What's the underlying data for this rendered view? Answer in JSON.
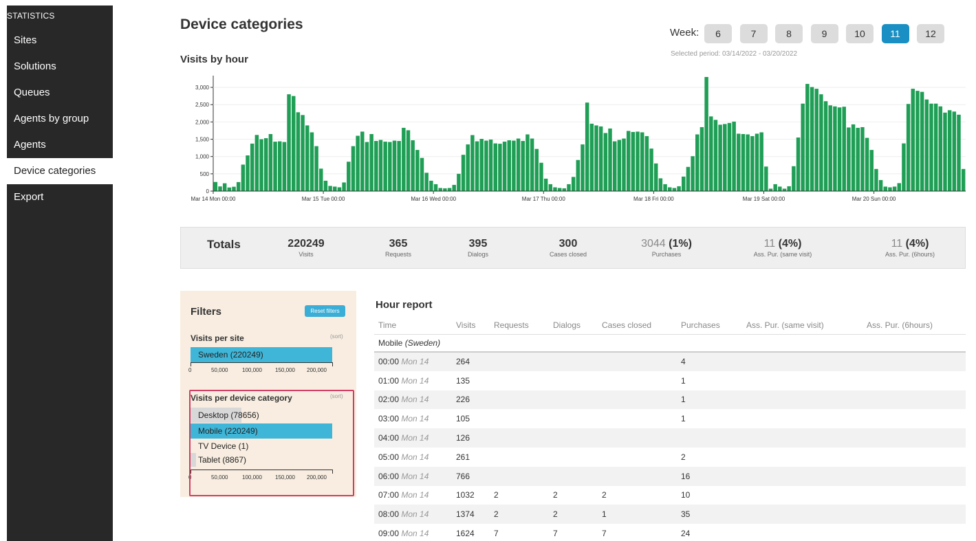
{
  "sidebar": {
    "header": "STATISTICS",
    "items": [
      {
        "label": "Sites"
      },
      {
        "label": "Solutions"
      },
      {
        "label": "Queues"
      },
      {
        "label": "Agents by group"
      },
      {
        "label": "Agents"
      },
      {
        "label": "Device categories",
        "active": true
      },
      {
        "label": "Export"
      }
    ]
  },
  "page": {
    "title": "Device categories",
    "week_label": "Week:",
    "weeks": [
      "6",
      "7",
      "8",
      "9",
      "10",
      "11",
      "12"
    ],
    "active_week": "11",
    "period": "Selected period: 03/14/2022 - 03/20/2022"
  },
  "chart_data": {
    "type": "bar",
    "title": "Visits by hour",
    "y_ticks": [
      "0",
      "500",
      "1,000",
      "1,500",
      "2,000",
      "2,500",
      "3,000"
    ],
    "ylim": [
      0,
      3300
    ],
    "x_labels": [
      "Mar 14 Mon 00:00",
      "Mar 15 Tue 00:00",
      "Mar 16 Wed 00:00",
      "Mar 17 Thu 00:00",
      "Mar 18 Fri 00:00",
      "Mar 19 Sat 00:00",
      "Mar 20 Sun 00:00"
    ],
    "bar_color": "#1f9e55",
    "values": [
      264,
      135,
      226,
      105,
      126,
      261,
      766,
      1032,
      1374,
      1624,
      1500,
      1530,
      1650,
      1430,
      1440,
      1420,
      2800,
      2750,
      2280,
      2200,
      1900,
      1700,
      1300,
      650,
      300,
      150,
      130,
      110,
      250,
      850,
      1300,
      1600,
      1720,
      1420,
      1650,
      1450,
      1480,
      1430,
      1420,
      1460,
      1450,
      1830,
      1760,
      1470,
      1190,
      960,
      530,
      300,
      200,
      90,
      80,
      90,
      180,
      500,
      1050,
      1350,
      1620,
      1440,
      1510,
      1460,
      1490,
      1380,
      1370,
      1430,
      1470,
      1460,
      1520,
      1450,
      1640,
      1520,
      1220,
      820,
      360,
      200,
      110,
      90,
      80,
      200,
      410,
      900,
      1350,
      2560,
      1950,
      1900,
      1870,
      1680,
      1810,
      1440,
      1480,
      1520,
      1740,
      1710,
      1720,
      1700,
      1590,
      1230,
      800,
      370,
      200,
      110,
      90,
      140,
      420,
      700,
      1010,
      1640,
      1850,
      3300,
      2160,
      2060,
      1920,
      1940,
      1970,
      2010,
      1660,
      1650,
      1640,
      1590,
      1660,
      1700,
      710,
      70,
      200,
      130,
      70,
      140,
      720,
      1550,
      2530,
      3100,
      3010,
      2960,
      2800,
      2600,
      2480,
      2450,
      2420,
      2440,
      1840,
      1930,
      1830,
      1850,
      1540,
      1190,
      640,
      320,
      130,
      110,
      130,
      230,
      1380,
      2520,
      2960,
      2900,
      2870,
      2650,
      2530,
      2530,
      2450,
      2270,
      2340,
      2300,
      2210,
      640
    ]
  },
  "totals": {
    "label": "Totals",
    "cells": [
      {
        "value": "220249",
        "sub": "Visits"
      },
      {
        "value": "365",
        "sub": "Requests"
      },
      {
        "value": "395",
        "sub": "Dialogs"
      },
      {
        "value": "300",
        "sub": "Cases closed"
      },
      {
        "value_muted": "3044",
        "value_pct": "(1%)",
        "sub": "Purchases"
      },
      {
        "value_muted": "11",
        "value_pct": "(4%)",
        "sub": "Ass. Pur. (same visit)"
      },
      {
        "value_muted": "11",
        "value_pct": "(4%)",
        "sub": "Ass. Pur. (6hours)"
      }
    ]
  },
  "filters": {
    "title": "Filters",
    "reset_label": "Reset filters",
    "sort_label": "(sort)",
    "site": {
      "heading": "Visits per site",
      "bars": [
        {
          "label": "Sweden (220249)",
          "value": 220249
        }
      ],
      "ticks": [
        "0",
        "50,000",
        "100,000",
        "150,000",
        "200,000"
      ]
    },
    "device": {
      "heading": "Visits per device category",
      "bars": [
        {
          "label": "Desktop (78656)",
          "value": 78656
        },
        {
          "label": "Mobile (220249)",
          "value": 220249
        },
        {
          "label": "TV Device (1)",
          "value": 1
        },
        {
          "label": "Tablet (8867)",
          "value": 8867
        }
      ],
      "ticks": [
        "0",
        "50,000",
        "100,000",
        "150,000",
        "200,000"
      ]
    }
  },
  "hour_report": {
    "title": "Hour report",
    "columns": [
      "Time",
      "Visits",
      "Requests",
      "Dialogs",
      "Cases closed",
      "Purchases",
      "Ass. Pur. (same visit)",
      "Ass. Pur. (6hours)"
    ],
    "group_label": "Mobile",
    "group_country": "(Sweden)",
    "rows": [
      {
        "time": "00:00",
        "day": "Mon 14",
        "visits": "264",
        "requests": "",
        "dialogs": "",
        "cases": "",
        "purchases": "4"
      },
      {
        "time": "01:00",
        "day": "Mon 14",
        "visits": "135",
        "requests": "",
        "dialogs": "",
        "cases": "",
        "purchases": "1"
      },
      {
        "time": "02:00",
        "day": "Mon 14",
        "visits": "226",
        "requests": "",
        "dialogs": "",
        "cases": "",
        "purchases": "1"
      },
      {
        "time": "03:00",
        "day": "Mon 14",
        "visits": "105",
        "requests": "",
        "dialogs": "",
        "cases": "",
        "purchases": "1"
      },
      {
        "time": "04:00",
        "day": "Mon 14",
        "visits": "126",
        "requests": "",
        "dialogs": "",
        "cases": "",
        "purchases": ""
      },
      {
        "time": "05:00",
        "day": "Mon 14",
        "visits": "261",
        "requests": "",
        "dialogs": "",
        "cases": "",
        "purchases": "2"
      },
      {
        "time": "06:00",
        "day": "Mon 14",
        "visits": "766",
        "requests": "",
        "dialogs": "",
        "cases": "",
        "purchases": "16"
      },
      {
        "time": "07:00",
        "day": "Mon 14",
        "visits": "1032",
        "requests": "2",
        "dialogs": "2",
        "cases": "2",
        "purchases": "10"
      },
      {
        "time": "08:00",
        "day": "Mon 14",
        "visits": "1374",
        "requests": "2",
        "dialogs": "2",
        "cases": "1",
        "purchases": "35"
      },
      {
        "time": "09:00",
        "day": "Mon 14",
        "visits": "1624",
        "requests": "7",
        "dialogs": "7",
        "cases": "7",
        "purchases": "24"
      }
    ]
  }
}
